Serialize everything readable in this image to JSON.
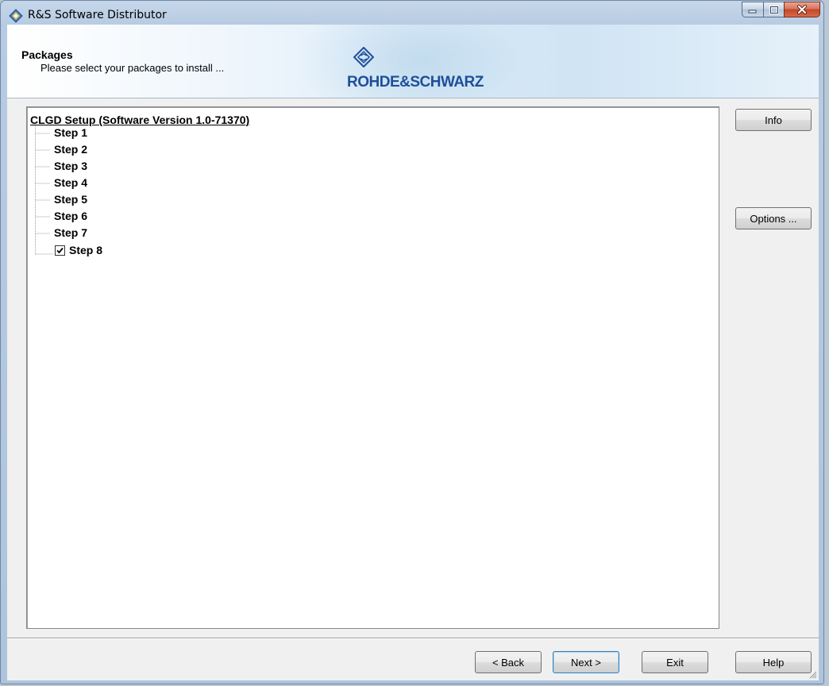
{
  "window": {
    "title": "R&S Software Distributor"
  },
  "header": {
    "title": "Packages",
    "subtitle": "Please select your packages to install ...",
    "logo_text": "ROHDE&SCHWARZ"
  },
  "tree": {
    "root_label": "CLGD Setup (Software Version 1.0-71370)",
    "items": [
      {
        "label": "Step 1",
        "checkbox": false
      },
      {
        "label": "Step 2",
        "checkbox": false
      },
      {
        "label": "Step 3",
        "checkbox": false
      },
      {
        "label": "Step 4",
        "checkbox": false
      },
      {
        "label": "Step 5",
        "checkbox": false
      },
      {
        "label": "Step 6",
        "checkbox": false
      },
      {
        "label": "Step 7",
        "checkbox": false
      },
      {
        "label": "Step 8",
        "checkbox": true,
        "checked": true
      }
    ]
  },
  "side_buttons": {
    "info": "Info",
    "options": "Options ..."
  },
  "footer_buttons": {
    "back": "< Back",
    "next": "Next >",
    "exit": "Exit",
    "help": "Help"
  },
  "colors": {
    "logo_blue": "#1e4f9a",
    "close_red": "#c4452a"
  },
  "icons": {
    "app": "rs-diamond-icon",
    "logo": "rs-diamond-logo-icon",
    "minimize": "minimize-icon",
    "maximize": "maximize-icon",
    "close": "close-icon",
    "check": "checkmark-icon",
    "grip": "resize-grip-icon"
  }
}
